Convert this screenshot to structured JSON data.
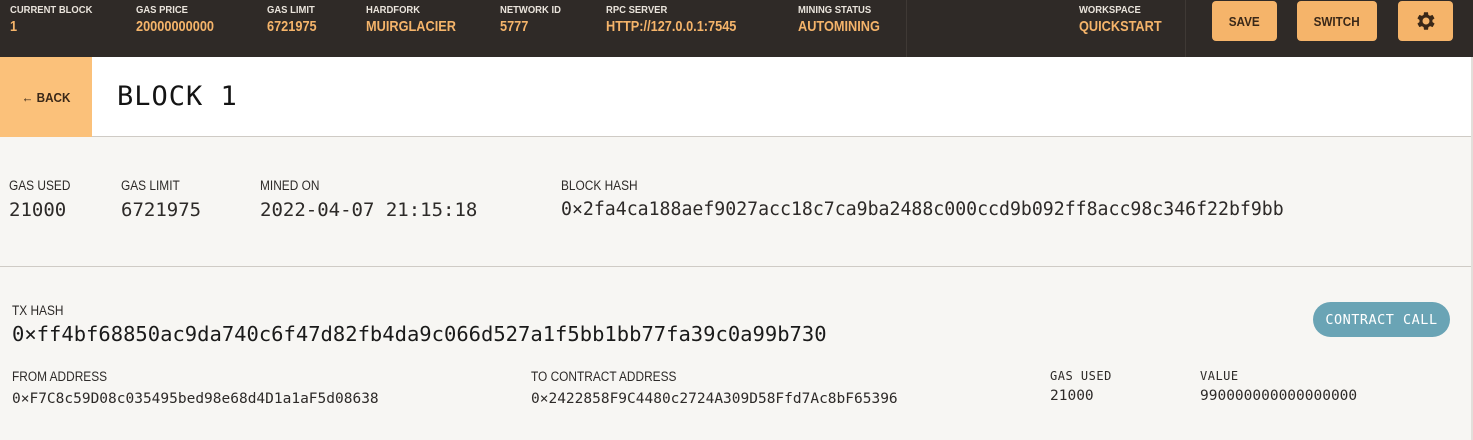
{
  "topbar": {
    "stats": {
      "current_block": {
        "label": "CURRENT BLOCK",
        "value": "1"
      },
      "gas_price": {
        "label": "GAS PRICE",
        "value": "20000000000"
      },
      "gas_limit": {
        "label": "GAS LIMIT",
        "value": "6721975"
      },
      "hardfork": {
        "label": "HARDFORK",
        "value": "MUIRGLACIER"
      },
      "network_id": {
        "label": "NETWORK ID",
        "value": "5777"
      },
      "rpc_server": {
        "label": "RPC SERVER",
        "value": "HTTP://127.0.0.1:7545"
      },
      "mining_status": {
        "label": "MINING STATUS",
        "value": "AUTOMINING"
      },
      "workspace": {
        "label": "WORKSPACE",
        "value": "QUICKSTART"
      }
    },
    "save_label": "SAVE",
    "switch_label": "SWITCH",
    "settings_icon": "gear-icon"
  },
  "header": {
    "back_label": "← BACK",
    "title": "BLOCK 1"
  },
  "block": {
    "gas_used": {
      "label": "GAS USED",
      "value": "21000"
    },
    "gas_limit": {
      "label": "GAS LIMIT",
      "value": "6721975"
    },
    "mined_on": {
      "label": "MINED ON",
      "value": "2022-04-07 21:15:18"
    },
    "block_hash": {
      "label": "BLOCK HASH",
      "value": "0×2fa4ca188aef9027acc18c7ca9ba2488c000ccd9b092ff8acc98c346f22bf9bb"
    }
  },
  "transaction": {
    "tx_hash_label": "TX HASH",
    "tx_hash": "0×ff4bf68850ac9da740c6f47d82fb4da9c066d527a1f5bb1bb77fa39c0a99b730",
    "type_badge": "CONTRACT CALL",
    "from": {
      "label": "FROM ADDRESS",
      "value": "0×F7C8c59D08c035495bed98e68d4D1a1aF5d08638"
    },
    "to": {
      "label": "TO CONTRACT ADDRESS",
      "value": "0×2422858F9C4480c2724A309D58Ffd7Ac8bF65396"
    },
    "gas_used": {
      "label": "GAS USED",
      "value": "21000"
    },
    "value": {
      "label": "VALUE",
      "value": "990000000000000000"
    }
  },
  "colors": {
    "topbar_bg": "#2f2a27",
    "accent": "#f5b46a",
    "back_bg": "#fbc17a",
    "badge": "#6aa4b5",
    "page_bg": "#f7f6f3"
  }
}
